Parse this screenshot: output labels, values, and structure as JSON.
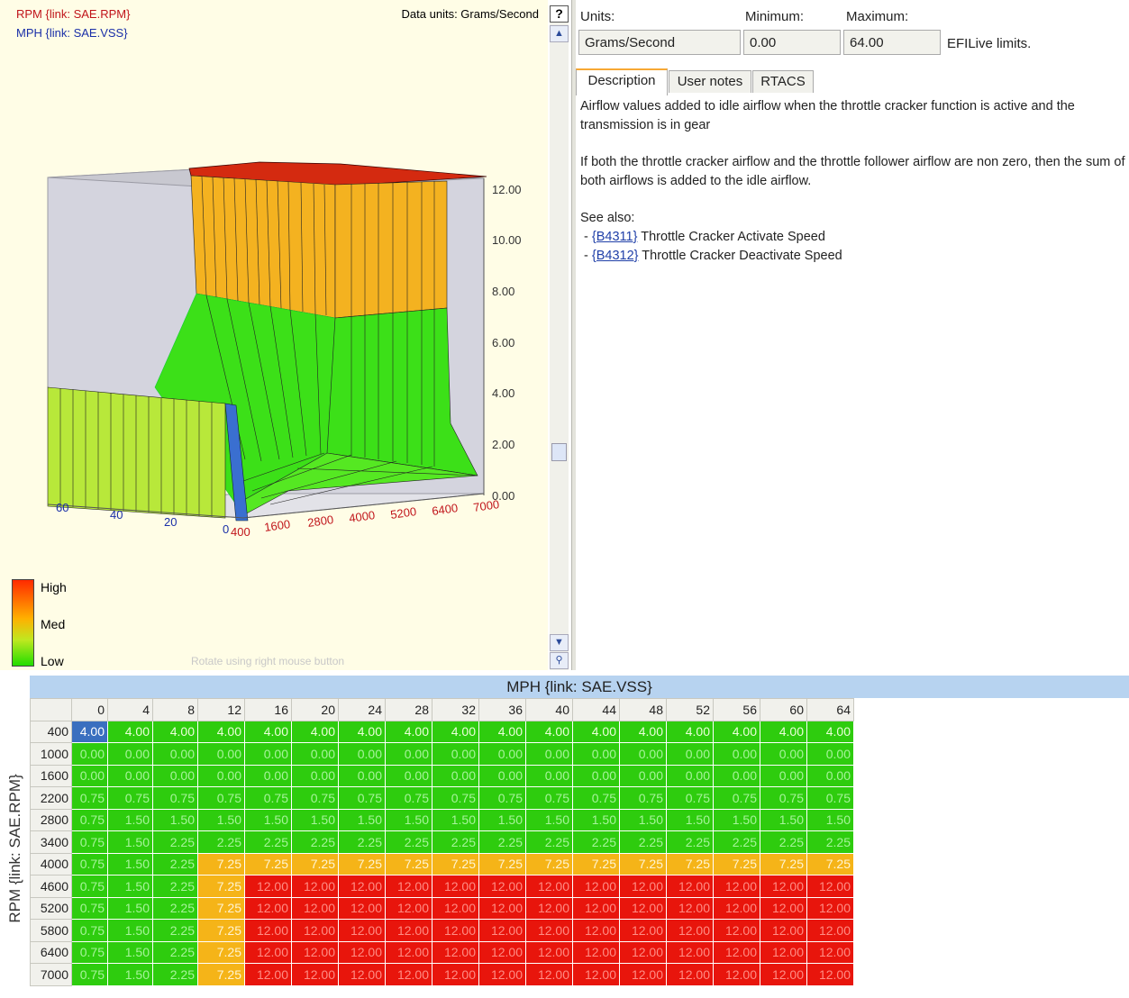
{
  "graph": {
    "y_axis_link": "RPM {link: SAE.RPM}",
    "x_axis_link": "MPH {link: SAE.VSS}",
    "data_units": "Data units: Grams/Second",
    "help_button": "?",
    "z_ticks": [
      "12.00",
      "10.00",
      "8.00",
      "6.00",
      "4.00",
      "2.00",
      "0.00"
    ],
    "rpm_ticks": [
      "400",
      "1600",
      "2800",
      "4000",
      "5200",
      "6400",
      "7000"
    ],
    "mph_ticks": [
      "60",
      "40",
      "20",
      "0"
    ],
    "legend": {
      "high": "High",
      "med": "Med",
      "low": "Low"
    },
    "hint": "Rotate using right mouse button"
  },
  "props": {
    "units_label": "Units:",
    "min_label": "Minimum:",
    "max_label": "Maximum:",
    "units_value": "Grams/Second",
    "min_value": "0.00",
    "max_value": "64.00",
    "limits_note": "EFILive limits."
  },
  "tabs": [
    {
      "label": "Description"
    },
    {
      "label": "User notes"
    },
    {
      "label": "RTACS"
    }
  ],
  "description": {
    "para1": "Airflow values added to idle airflow when the throttle cracker function is active and the transmission is in gear",
    "para2": "If both the throttle cracker airflow and the throttle follower airflow are non zero, then the sum of both airflows is added to the idle airflow.",
    "see_also": "See also:",
    "links": [
      {
        "code": "{B4311}",
        "text": "Throttle Cracker Activate Speed"
      },
      {
        "code": "{B4312}",
        "text": "Throttle Cracker Deactivate Speed"
      }
    ]
  },
  "table": {
    "col_axis_label": "MPH {link: SAE.VSS}",
    "row_axis_label": "RPM {link: SAE.RPM}",
    "cols": [
      "0",
      "4",
      "8",
      "12",
      "16",
      "20",
      "24",
      "28",
      "32",
      "36",
      "40",
      "44",
      "48",
      "52",
      "56",
      "60",
      "64"
    ],
    "rows": [
      {
        "rpm": "400",
        "values": [
          "4.00",
          "4.00",
          "4.00",
          "4.00",
          "4.00",
          "4.00",
          "4.00",
          "4.00",
          "4.00",
          "4.00",
          "4.00",
          "4.00",
          "4.00",
          "4.00",
          "4.00",
          "4.00",
          "4.00"
        ]
      },
      {
        "rpm": "1000",
        "values": [
          "0.00",
          "0.00",
          "0.00",
          "0.00",
          "0.00",
          "0.00",
          "0.00",
          "0.00",
          "0.00",
          "0.00",
          "0.00",
          "0.00",
          "0.00",
          "0.00",
          "0.00",
          "0.00",
          "0.00"
        ]
      },
      {
        "rpm": "1600",
        "values": [
          "0.00",
          "0.00",
          "0.00",
          "0.00",
          "0.00",
          "0.00",
          "0.00",
          "0.00",
          "0.00",
          "0.00",
          "0.00",
          "0.00",
          "0.00",
          "0.00",
          "0.00",
          "0.00",
          "0.00"
        ]
      },
      {
        "rpm": "2200",
        "values": [
          "0.75",
          "0.75",
          "0.75",
          "0.75",
          "0.75",
          "0.75",
          "0.75",
          "0.75",
          "0.75",
          "0.75",
          "0.75",
          "0.75",
          "0.75",
          "0.75",
          "0.75",
          "0.75",
          "0.75"
        ]
      },
      {
        "rpm": "2800",
        "values": [
          "0.75",
          "1.50",
          "1.50",
          "1.50",
          "1.50",
          "1.50",
          "1.50",
          "1.50",
          "1.50",
          "1.50",
          "1.50",
          "1.50",
          "1.50",
          "1.50",
          "1.50",
          "1.50",
          "1.50"
        ]
      },
      {
        "rpm": "3400",
        "values": [
          "0.75",
          "1.50",
          "2.25",
          "2.25",
          "2.25",
          "2.25",
          "2.25",
          "2.25",
          "2.25",
          "2.25",
          "2.25",
          "2.25",
          "2.25",
          "2.25",
          "2.25",
          "2.25",
          "2.25"
        ]
      },
      {
        "rpm": "4000",
        "values": [
          "0.75",
          "1.50",
          "2.25",
          "7.25",
          "7.25",
          "7.25",
          "7.25",
          "7.25",
          "7.25",
          "7.25",
          "7.25",
          "7.25",
          "7.25",
          "7.25",
          "7.25",
          "7.25",
          "7.25"
        ]
      },
      {
        "rpm": "4600",
        "values": [
          "0.75",
          "1.50",
          "2.25",
          "7.25",
          "12.00",
          "12.00",
          "12.00",
          "12.00",
          "12.00",
          "12.00",
          "12.00",
          "12.00",
          "12.00",
          "12.00",
          "12.00",
          "12.00",
          "12.00"
        ]
      },
      {
        "rpm": "5200",
        "values": [
          "0.75",
          "1.50",
          "2.25",
          "7.25",
          "12.00",
          "12.00",
          "12.00",
          "12.00",
          "12.00",
          "12.00",
          "12.00",
          "12.00",
          "12.00",
          "12.00",
          "12.00",
          "12.00",
          "12.00"
        ]
      },
      {
        "rpm": "5800",
        "values": [
          "0.75",
          "1.50",
          "2.25",
          "7.25",
          "12.00",
          "12.00",
          "12.00",
          "12.00",
          "12.00",
          "12.00",
          "12.00",
          "12.00",
          "12.00",
          "12.00",
          "12.00",
          "12.00",
          "12.00"
        ]
      },
      {
        "rpm": "6400",
        "values": [
          "0.75",
          "1.50",
          "2.25",
          "7.25",
          "12.00",
          "12.00",
          "12.00",
          "12.00",
          "12.00",
          "12.00",
          "12.00",
          "12.00",
          "12.00",
          "12.00",
          "12.00",
          "12.00",
          "12.00"
        ]
      },
      {
        "rpm": "7000",
        "values": [
          "0.75",
          "1.50",
          "2.25",
          "7.25",
          "12.00",
          "12.00",
          "12.00",
          "12.00",
          "12.00",
          "12.00",
          "12.00",
          "12.00",
          "12.00",
          "12.00",
          "12.00",
          "12.00",
          "12.00"
        ]
      }
    ]
  }
}
